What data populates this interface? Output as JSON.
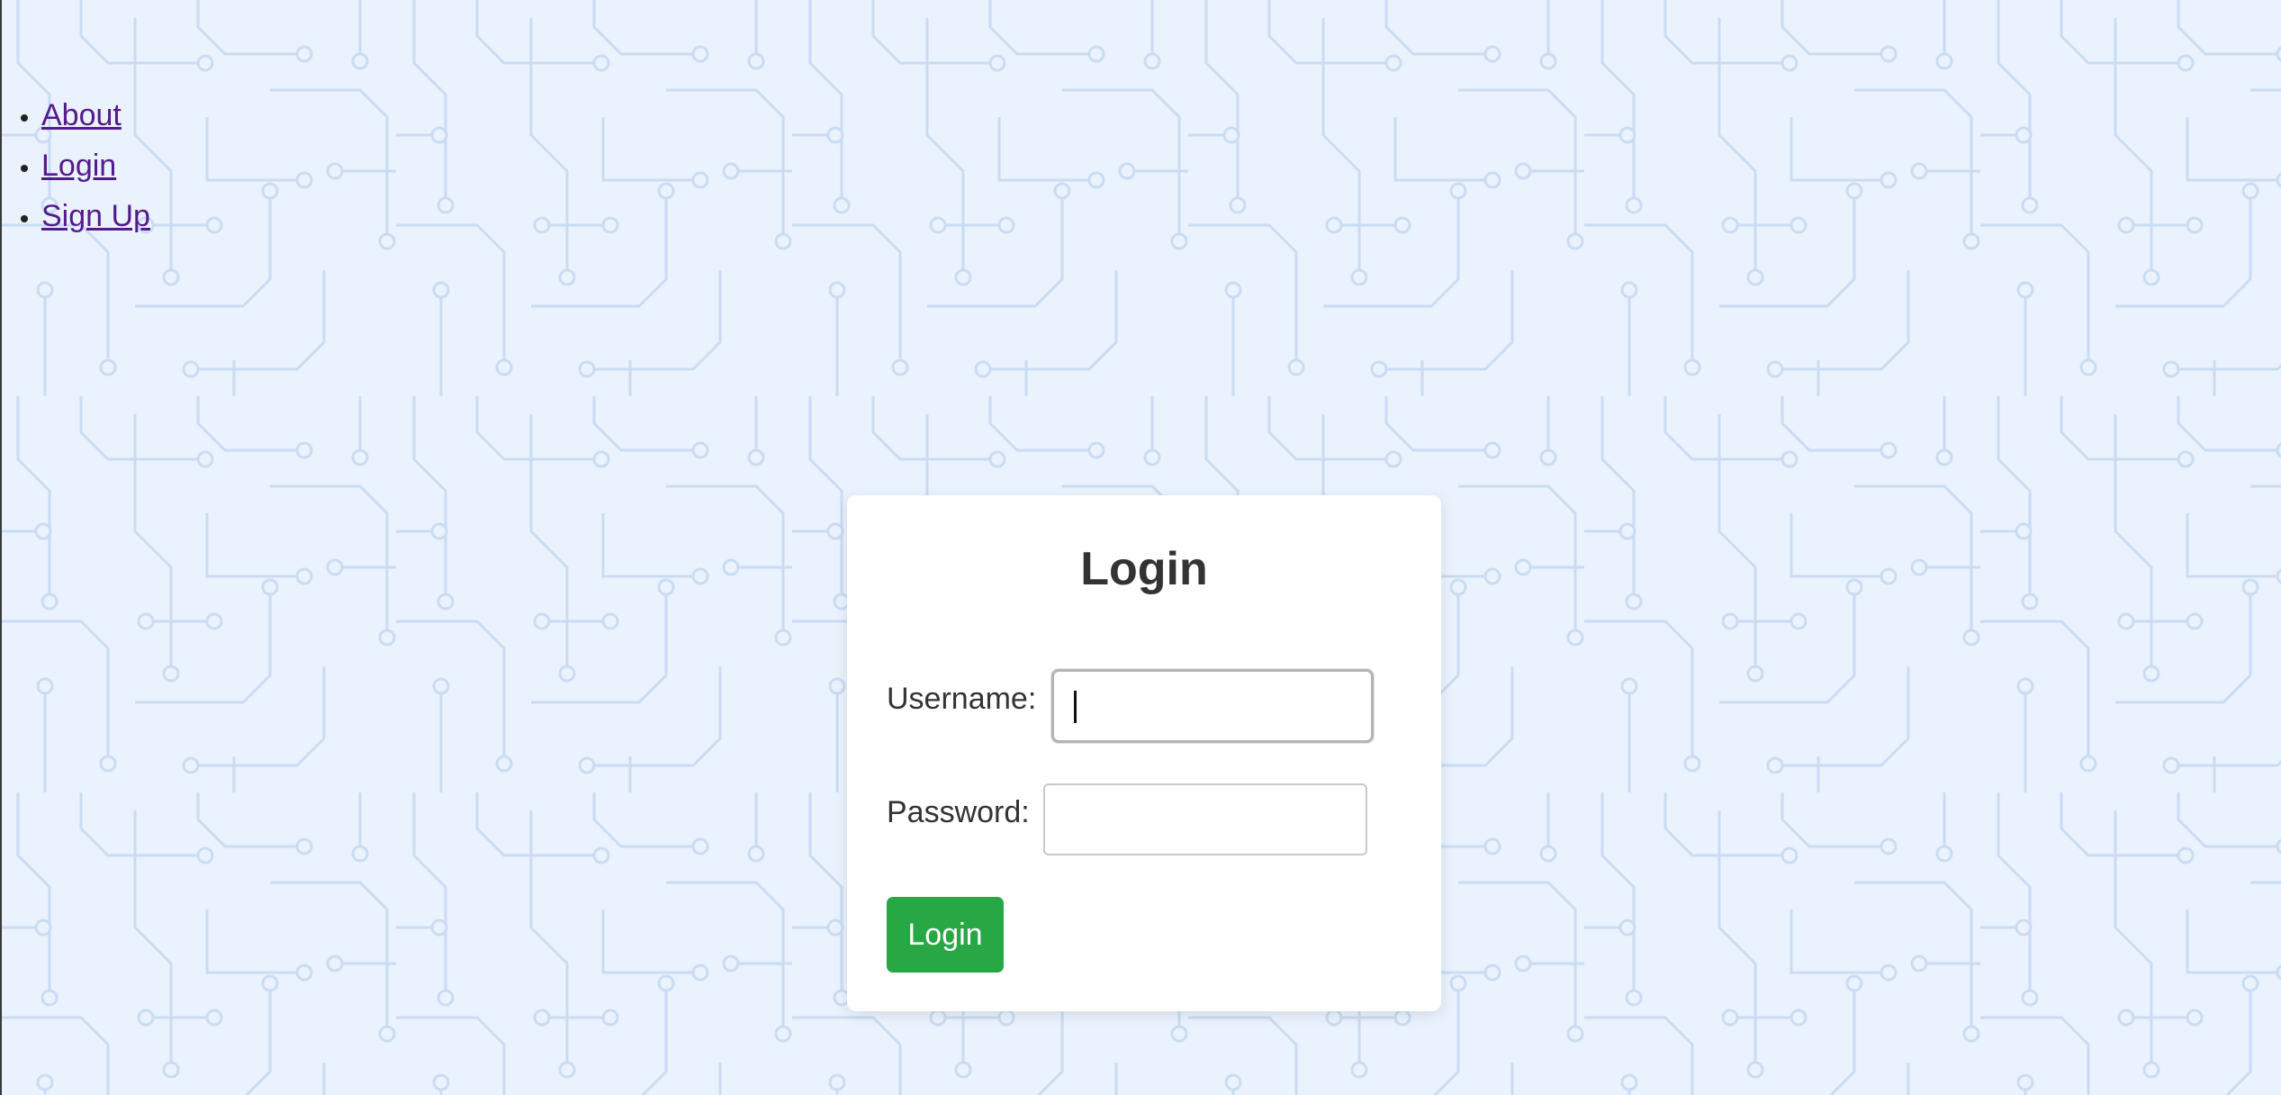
{
  "nav": {
    "items": [
      {
        "label": "About"
      },
      {
        "label": "Login"
      },
      {
        "label": "Sign Up"
      }
    ]
  },
  "login_form": {
    "title": "Login",
    "username_label": "Username:",
    "username_value": "",
    "password_label": "Password:",
    "password_value": "",
    "submit_label": "Login"
  },
  "colors": {
    "background": "#eaf2fd",
    "circuit_trace": "#c9dcf3",
    "link_visited": "#551a8b",
    "button": "#28a745",
    "card": "#ffffff"
  },
  "icons": {
    "background_pattern": "circuit-board-pattern"
  }
}
